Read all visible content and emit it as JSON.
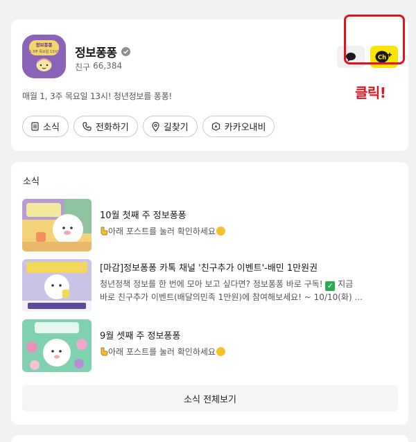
{
  "profile": {
    "name": "정보퐁퐁",
    "friends_label": "친구",
    "friends_count": "66,384",
    "avatar_text_top": "정보퐁퐁",
    "avatar_text_mid": "1·3주 목요일 13시!",
    "description": "매월 1, 3주 목요일 13시! 청년정보를 퐁퐁!",
    "channel_icon_text": "Ch",
    "actions": [
      {
        "label": "소식",
        "icon": "document-icon"
      },
      {
        "label": "전화하기",
        "icon": "phone-icon"
      },
      {
        "label": "길찾기",
        "icon": "location-pin-icon"
      },
      {
        "label": "카카오내비",
        "icon": "navi-icon"
      }
    ]
  },
  "annotation": {
    "text": "클릭!",
    "color": "#e0141e"
  },
  "news": {
    "title": "소식",
    "items": [
      {
        "title": "10월 첫째 주 정보퐁퐁",
        "subtitle": "아래 포스트를 눌러 확인하세요",
        "thumb_text": "10월 첫째주 / 정보를 퐁퐁"
      },
      {
        "title": "[마감]정보퐁퐁 카톡 채널 '친구추가 이벤트'-배민 1만원권",
        "line1_a": "청년정책 정보를 한 번에 모아 보고 싶다면? 정보퐁퐁 바로 구독!",
        "line1_b": "지금",
        "line2": "바로 친구추가 이벤트(배달의민족 1만원)에 참여해보세요! ~ 10/10(화) ...",
        "thumb_text": "정보퐁퐁 / I WANT SUBSCRIBE"
      },
      {
        "title": "9월 셋째 주 정보퐁퐁",
        "subtitle": "아래 포스트를 눌러 확인하세요",
        "thumb_text": "정보퐁퐁"
      }
    ],
    "more_label": "소식 전체보기"
  },
  "colors": {
    "kakao_yellow": "#fee500",
    "avatar_purple": "#8a62b8",
    "highlight_red": "#e0141e",
    "background": "#f2f2f2"
  }
}
